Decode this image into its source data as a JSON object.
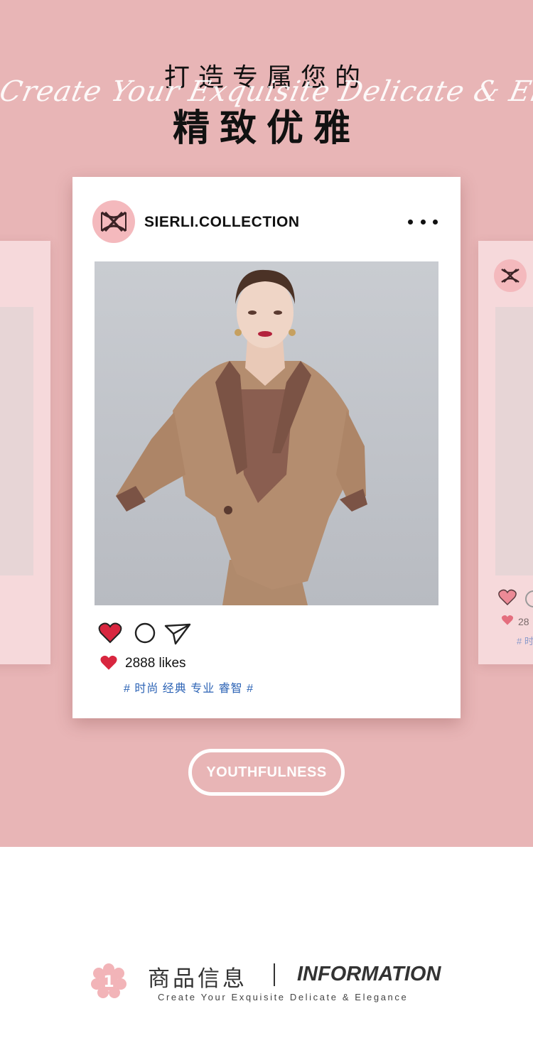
{
  "hero": {
    "headline_top": "打造专属您的",
    "script_line": "Create Your Exquisite Delicate & Elegance",
    "headline_main": "精致优雅"
  },
  "post": {
    "account_name": "SIERLI.COLLECTION",
    "likes": "2888 likes",
    "tags": "# 时尚 经典 专业 睿智 #"
  },
  "side_card": {
    "likes_fragment": "28",
    "tags_fragment": "# 时"
  },
  "pill": {
    "label": "YOUTHFULNESS"
  },
  "info": {
    "number": "1",
    "title_cn": "商品信息",
    "title_en": "INFORMATION",
    "subtitle": "Create Your Exquisite Delicate & Elegance"
  },
  "icons": {
    "more": "more-dots-icon",
    "like": "heart-icon",
    "comment": "comment-circle-icon",
    "share": "send-icon",
    "logo": "brand-monogram-icon"
  },
  "colors": {
    "hero_bg": "#e8b5b6",
    "heart": "#d8263f",
    "tag_blue": "#2c63b5",
    "avatar_pink": "#f4b9bd",
    "flower_pink": "#f2b4b8"
  }
}
